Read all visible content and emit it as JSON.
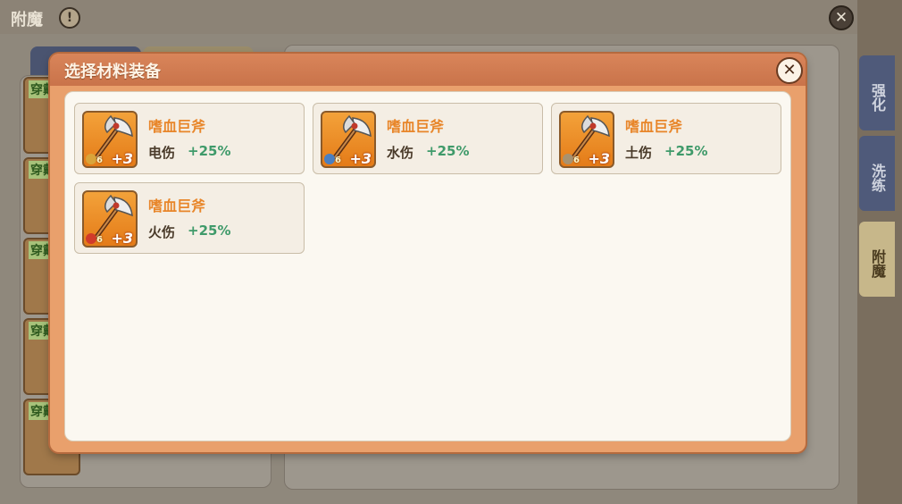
{
  "background": {
    "window_title": "附魔",
    "help_icon": "exclamation-icon",
    "close_icon": "close-icon",
    "slot_label": "穿戴",
    "side_tabs": [
      {
        "label": "强化",
        "active": false
      },
      {
        "label": "洗练",
        "active": false
      },
      {
        "label": "附魔",
        "active": true
      }
    ]
  },
  "modal": {
    "title": "选择材料装备",
    "close_icon": "close-icon",
    "items": [
      {
        "name": "嗜血巨斧",
        "attr": "电伤",
        "value": "+25%",
        "level": "6",
        "plus": "+3",
        "element_color": "#d9a43a"
      },
      {
        "name": "嗜血巨斧",
        "attr": "水伤",
        "value": "+25%",
        "level": "6",
        "plus": "+3",
        "element_color": "#4a7fc1"
      },
      {
        "name": "嗜血巨斧",
        "attr": "土伤",
        "value": "+25%",
        "level": "6",
        "plus": "+3",
        "element_color": "#a89270"
      },
      {
        "name": "嗜血巨斧",
        "attr": "火伤",
        "value": "+25%",
        "level": "6",
        "plus": "+3",
        "element_color": "#d13a2a"
      }
    ]
  },
  "colors": {
    "item_name": "#e8862a",
    "attr_value": "#3f9a6a",
    "modal_frame": "#e9a06c"
  }
}
